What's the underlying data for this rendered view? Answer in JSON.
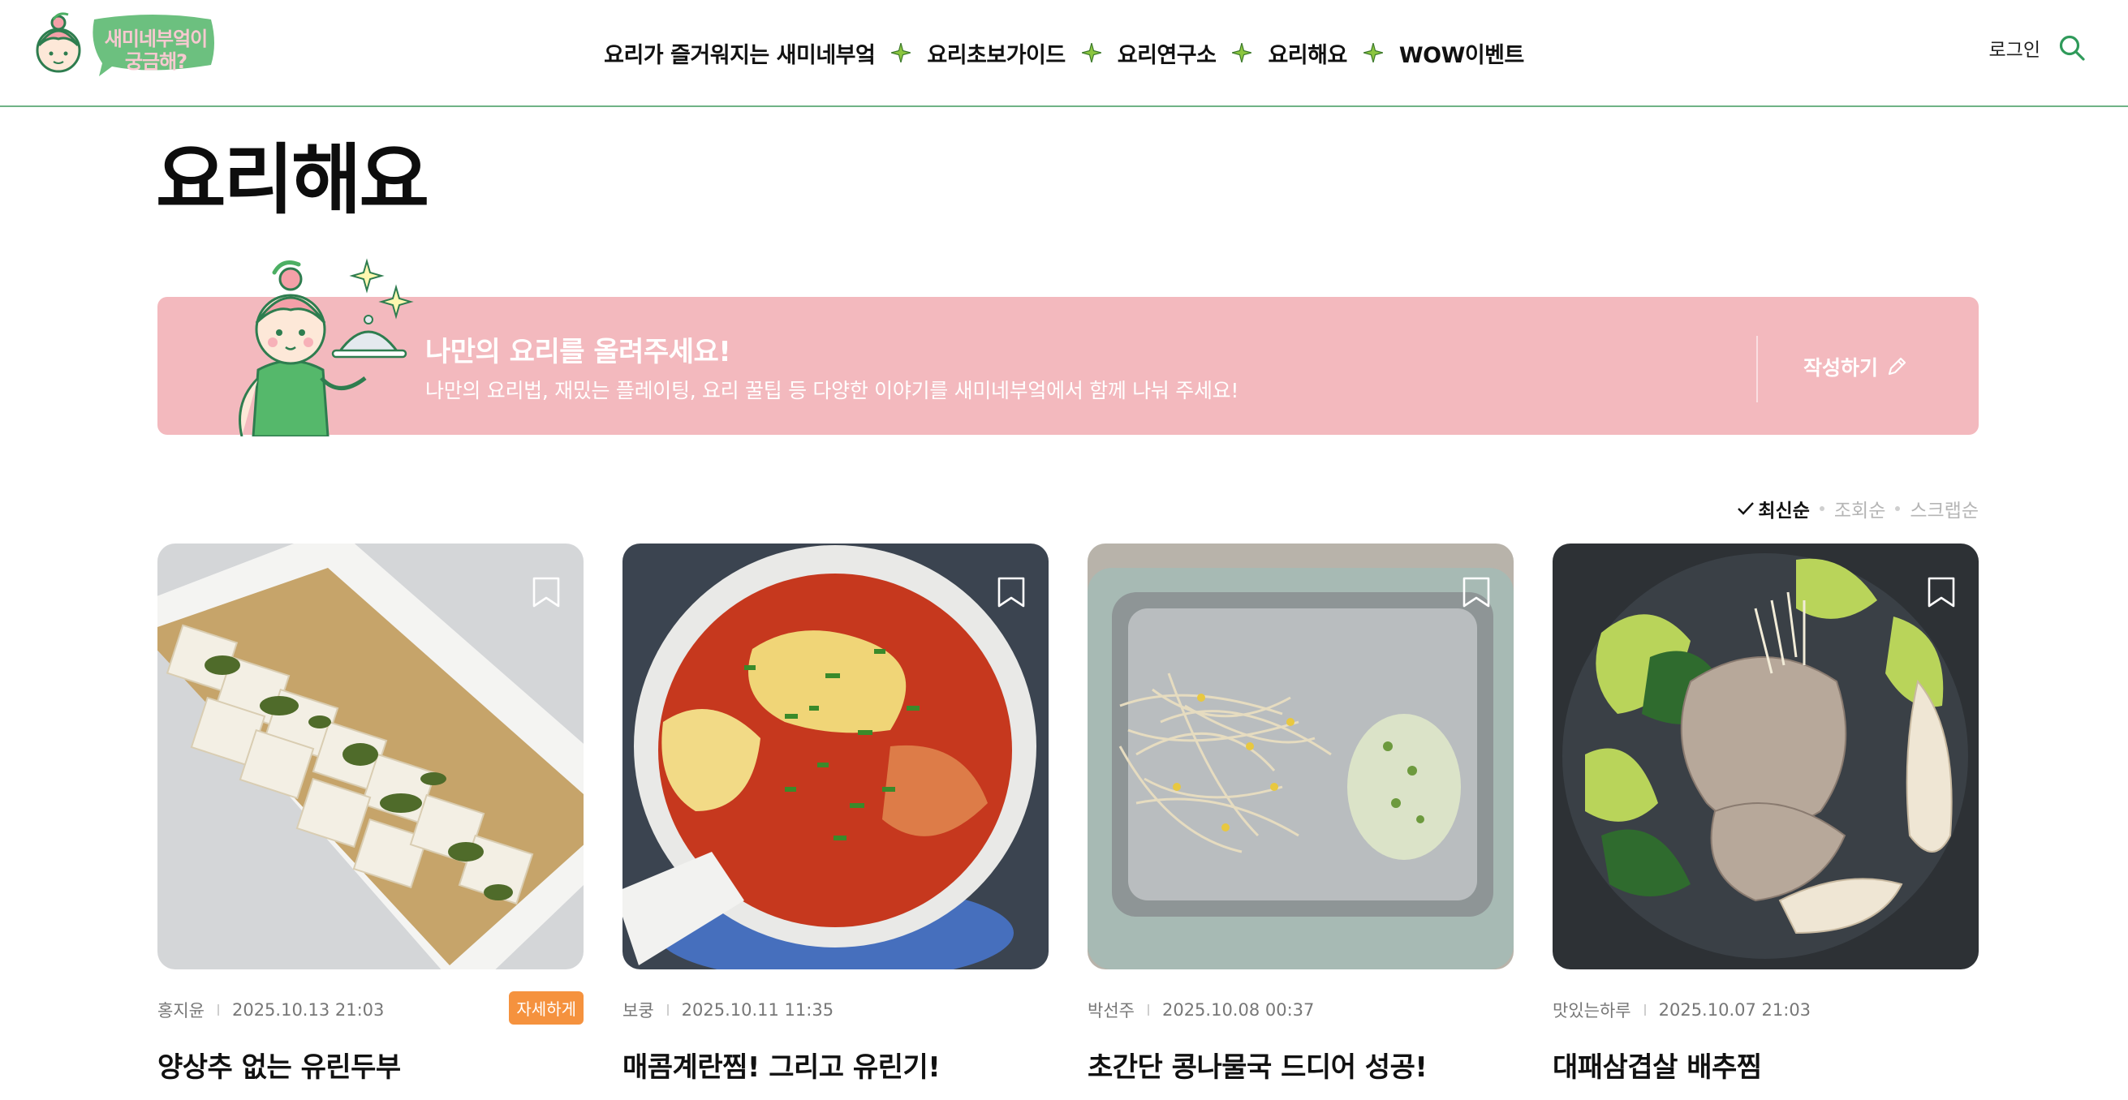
{
  "header": {
    "logo_text": "새미네부엌이 궁금해?",
    "nav": [
      {
        "label": "요리가 즐거워지는 새미네부엌"
      },
      {
        "label": "요리초보가이드"
      },
      {
        "label": "요리연구소"
      },
      {
        "label": "요리해요"
      },
      {
        "label": "WOW이벤트"
      }
    ],
    "login_label": "로그인"
  },
  "page": {
    "title": "요리해요"
  },
  "banner": {
    "title": "나만의 요리를 올려주세요!",
    "description": "나만의 요리법, 재밌는 플레이팅, 요리 꿀팁 등 다양한 이야기를 새미네부엌에서 함께 나눠 주세요!",
    "write_label": "작성하기"
  },
  "sort": {
    "options": [
      {
        "label": "최신순",
        "active": true
      },
      {
        "label": "조회순",
        "active": false
      },
      {
        "label": "스크랩순",
        "active": false
      }
    ]
  },
  "cards": [
    {
      "author": "홍지윤",
      "date": "2025.10.13 21:03",
      "badge": "자세하게",
      "title": "양상추 없는 유린두부",
      "image_icon": "tofu-dish-photo"
    },
    {
      "author": "보쿵",
      "date": "2025.10.11 11:35",
      "badge": "",
      "title": "매콤계란찜! 그리고 유린기!",
      "image_icon": "egg-stew-photo"
    },
    {
      "author": "박선주",
      "date": "2025.10.08 00:37",
      "badge": "",
      "title": "초간단 콩나물국 드디어 성공!",
      "image_icon": "bean-sprout-photo"
    },
    {
      "author": "맛있는하루",
      "date": "2025.10.07 21:03",
      "badge": "",
      "title": "대패삼겹살 배추찜",
      "image_icon": "pork-cabbage-photo"
    }
  ],
  "colors": {
    "accent_green": "#6fb386",
    "banner_pink": "#f3b9be",
    "badge_orange": "#f5923e"
  }
}
